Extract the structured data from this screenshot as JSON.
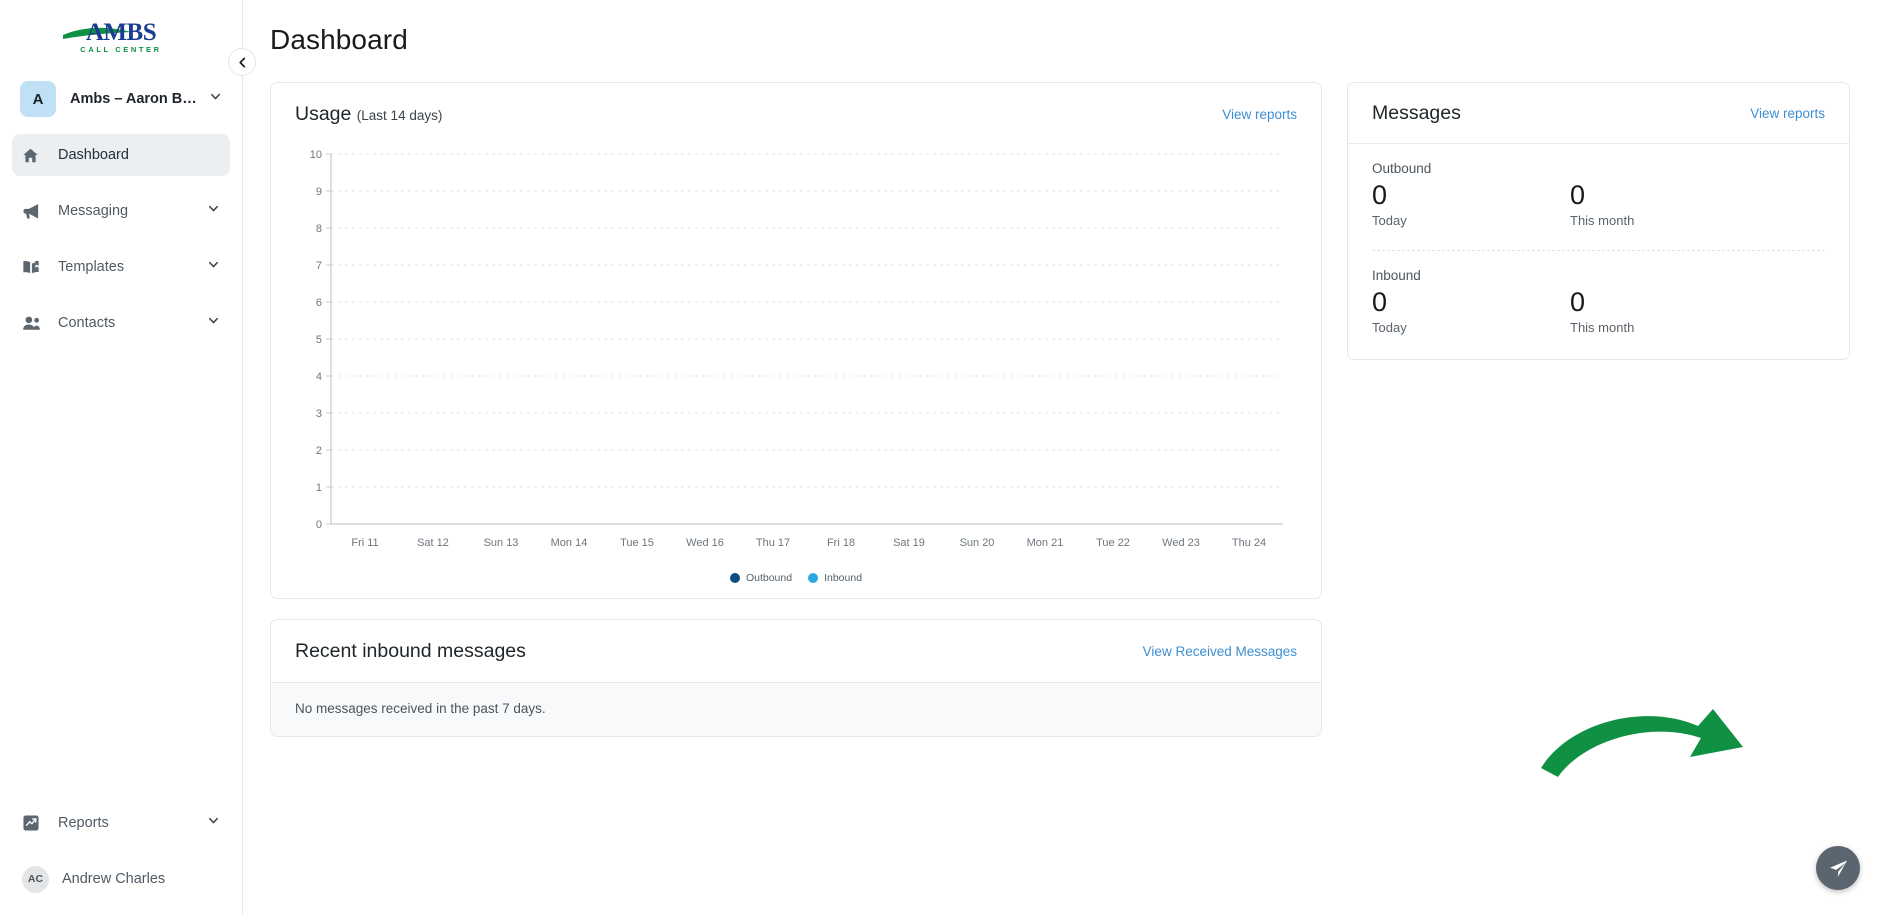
{
  "sidebar": {
    "logo": {
      "name": "AMBS",
      "tagline": "CALL CENTER"
    },
    "collapse_label": "‹",
    "account": {
      "badge": "A",
      "name": "Ambs – Aaron B…"
    },
    "items": [
      {
        "label": "Dashboard",
        "icon": "home-icon",
        "active": true,
        "has_chevron": false
      },
      {
        "label": "Messaging",
        "icon": "megaphone-icon",
        "active": false,
        "has_chevron": true
      },
      {
        "label": "Templates",
        "icon": "book-icon",
        "active": false,
        "has_chevron": true
      },
      {
        "label": "Contacts",
        "icon": "people-icon",
        "active": false,
        "has_chevron": true
      }
    ],
    "bottom_items": [
      {
        "label": "Reports",
        "icon": "trending-up-icon",
        "has_chevron": true
      }
    ],
    "user": {
      "initials": "AC",
      "name": "Andrew Charles"
    }
  },
  "header": {
    "title": "Dashboard"
  },
  "usage_card": {
    "title": "Usage",
    "subtitle": "(Last 14 days)",
    "view_reports": "View reports"
  },
  "messages_card": {
    "title": "Messages",
    "view_reports": "View reports",
    "sections": [
      {
        "label": "Outbound",
        "stats": [
          {
            "value": "0",
            "caption": "Today"
          },
          {
            "value": "0",
            "caption": "This month"
          }
        ]
      },
      {
        "label": "Inbound",
        "stats": [
          {
            "value": "0",
            "caption": "Today"
          },
          {
            "value": "0",
            "caption": "This month"
          }
        ]
      }
    ]
  },
  "recent_card": {
    "title": "Recent inbound messages",
    "link": "View Received Messages",
    "empty_text": "No messages received in the past 7 days."
  },
  "fab": {
    "icon": "send-icon",
    "color": "#5a6570"
  },
  "annotation": {
    "type": "curved-arrow",
    "color": "#0f9043"
  },
  "colors": {
    "outbound": "#0f4c81",
    "inbound": "#2aa8e0",
    "link": "#3d8fd1",
    "accent_green": "#0f9043",
    "logo_blue": "#1b3d8f",
    "logo_green": "#0f9043"
  },
  "chart_data": {
    "type": "line",
    "title": "Usage (Last 14 days)",
    "xlabel": "",
    "ylabel": "",
    "ylim": [
      0,
      10
    ],
    "yticks": [
      0,
      1,
      2,
      3,
      4,
      5,
      6,
      7,
      8,
      9,
      10
    ],
    "grid": true,
    "legend_position": "bottom",
    "categories": [
      "Fri 11",
      "Sat 12",
      "Sun 13",
      "Mon 14",
      "Tue 15",
      "Wed 16",
      "Thu 17",
      "Fri 18",
      "Sat 19",
      "Sun 20",
      "Mon 21",
      "Tue 22",
      "Wed 23",
      "Thu 24"
    ],
    "series": [
      {
        "name": "Outbound",
        "color": "#0f4c81",
        "values": [
          0,
          0,
          0,
          0,
          0,
          0,
          0,
          0,
          0,
          0,
          0,
          0,
          0,
          0
        ]
      },
      {
        "name": "Inbound",
        "color": "#2aa8e0",
        "values": [
          0,
          0,
          0,
          0,
          0,
          0,
          0,
          0,
          0,
          0,
          0,
          0,
          0,
          0
        ]
      }
    ]
  }
}
